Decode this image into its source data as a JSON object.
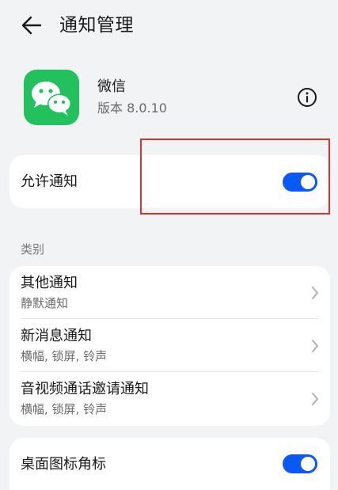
{
  "header": {
    "title": "通知管理",
    "back_icon": "arrow-left-icon"
  },
  "app": {
    "name": "微信",
    "version": "版本 8.0.10",
    "icon": "wechat-logo",
    "icon_color": "#22c15e",
    "info_icon": "info-circle-icon"
  },
  "allow_notifications": {
    "label": "允许通知",
    "enabled": true
  },
  "categories": {
    "section_label": "类别",
    "items": [
      {
        "title": "其他通知",
        "subtitle": "静默通知"
      },
      {
        "title": "新消息通知",
        "subtitle": "横幅, 锁屏, 铃声"
      },
      {
        "title": "音视频通话邀请通知",
        "subtitle": "横幅, 锁屏, 铃声"
      }
    ]
  },
  "badge": {
    "label": "桌面图标角标",
    "enabled": true
  },
  "colors": {
    "accent": "#0a59f7",
    "highlight": "#e0302a",
    "background": "#f1f3f5"
  }
}
